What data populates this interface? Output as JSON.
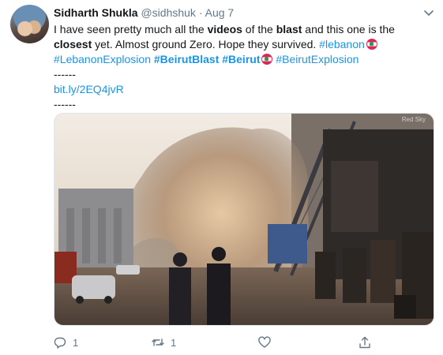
{
  "tweet": {
    "author_name": "Sidharth Shukla",
    "handle": "@sidhshuk",
    "separator": "·",
    "date": "Aug 7",
    "text": {
      "l1_a": "I have seen pretty much all the ",
      "l1_b": "videos",
      "l1_c": " of the ",
      "l1_d": "blast",
      "l1_e": " and this one is the",
      "l2_a": "closest",
      "l2_b": " yet. Almost ground Zero. Hope they survived.  ",
      "l2_tag": "#lebanon",
      "l3_tag1": "#LebanonExplosion",
      "l3_tag2": "#BeirutBlast",
      "l3_tag3": "#Beirut",
      "l3_tag4": "#BeirutExplosion",
      "divider1": "------",
      "url": "bit.ly/2EQ4jvR",
      "divider2": "------"
    },
    "watermark": "Red Sky"
  },
  "actions": {
    "reply_count": "1",
    "retweet_count": "1",
    "like_count": "",
    "share_count": ""
  },
  "icons": {
    "reply": "reply-icon",
    "retweet": "retweet-icon",
    "like": "heart-icon",
    "share": "share-icon",
    "flag": "lebanon-flag-icon",
    "caret": "chevron-down-icon"
  },
  "colors": {
    "link": "#1b95e0",
    "muted": "#657786",
    "text": "#14171a"
  }
}
